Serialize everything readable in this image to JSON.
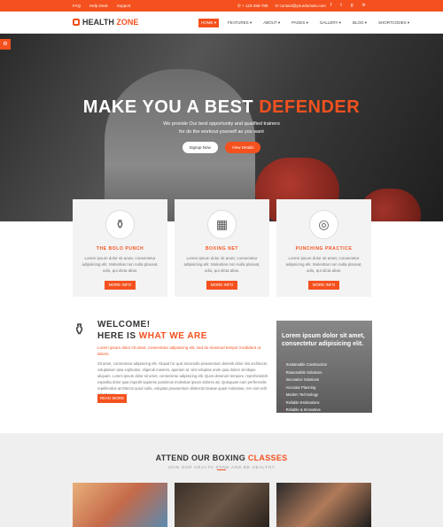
{
  "topbar": {
    "links": [
      "FAQ",
      "Help Desk",
      "Support"
    ],
    "phone": "+ 123-456-789",
    "email": "contact@yourdomain.com",
    "social_icons": [
      "facebook-icon",
      "twitter-icon",
      "google-plus-icon",
      "linkedin-icon"
    ]
  },
  "brand": {
    "name_part1": "HEALTH ",
    "name_part2": "ZONE"
  },
  "nav": {
    "items": [
      {
        "label": "HOME ▾",
        "active": true
      },
      {
        "label": "FEATURES ▾",
        "active": false
      },
      {
        "label": "ABOUT ▾",
        "active": false
      },
      {
        "label": "PAGES ▾",
        "active": false
      },
      {
        "label": "GALLERY ▾",
        "active": false
      },
      {
        "label": "BLOG ▾",
        "active": false
      },
      {
        "label": "SHORTCODES ▾",
        "active": false
      }
    ]
  },
  "hero": {
    "title_part1": "MAKE YOU A BEST ",
    "title_part2": "DEFENDER",
    "subtitle_line1": "We provide Our best opportunity and qualified trainers",
    "subtitle_line2": "for do the workout yourself as you want",
    "signup_label": "Signup Now",
    "details_label": "View Details"
  },
  "features": [
    {
      "icon": "bottle-icon",
      "title": "THE BOLO PUNCH",
      "text": "Lorem ipsum dolor sit amet, consectetur adipisicing elit. Molestias non nulla placeat, odio, qui dicta alias.",
      "button": "MORE INFO"
    },
    {
      "icon": "boxing-net-icon",
      "title": "BOXING NET",
      "text": "Lorem ipsum dolor sit amet, consectetur adipisicing elit. Molestias non nulla placeat, odio, qui dicta alias.",
      "button": "MORE INFO"
    },
    {
      "icon": "boxing-gloves-icon",
      "title": "PUNCHING PRACTICE",
      "text": "Lorem ipsum dolor sit amet, consectetur adipisicing elit. Molestias non nulla placeat, odio, qui dicta alias.",
      "button": "MORE INFO"
    }
  ],
  "welcome": {
    "heading_line1": "WELCOME!",
    "heading_line2_part1": "HERE IS ",
    "heading_line2_part2": "WHAT WE ARE",
    "lead": "Lorem ipsum dolor sit amet, consectetur adipisicing elit, sed do eiusmod tempor incididunt ut labore.",
    "body": "Sit amet, consectetur adipisicing elit. Aliquid hic quis reiciendis praesentium deleniti dolor nisi architecto voluptatum ipsa explicabo, eligendi maiores, aperiam at, sint voluptas unde quia dolore similique aliquam. Lorem ipsum dolor sit amet, consectetur adipisicing elit. Quos deserunt tempore, reprehenderit expedita dolor quia impedit sapiente possimus molestias ipsam dolores ab. Quisquam eum perferendis repellendus architecto quod nulla, voluptas praesentium distinctio beatae quasi molestias, rem sint velit voluptatum.",
    "button": "READ MORE"
  },
  "promo": {
    "title": "Lorem ipsum dolor sit amet, consectetur adipisicing elit.",
    "items": [
      "Sustainable Construction",
      "Reasonable Solutions",
      "Innovative Solutions",
      "Accurate Planning",
      "Modern Technology",
      "Reliable Estimations",
      "Reliable & Innovative"
    ]
  },
  "classes": {
    "title_part1": "ATTEND OUR BOXING ",
    "title_part2": "CLASSES",
    "subtitle": "JOIN OUR HEALTH ZONE AND BE HEALTHY"
  }
}
